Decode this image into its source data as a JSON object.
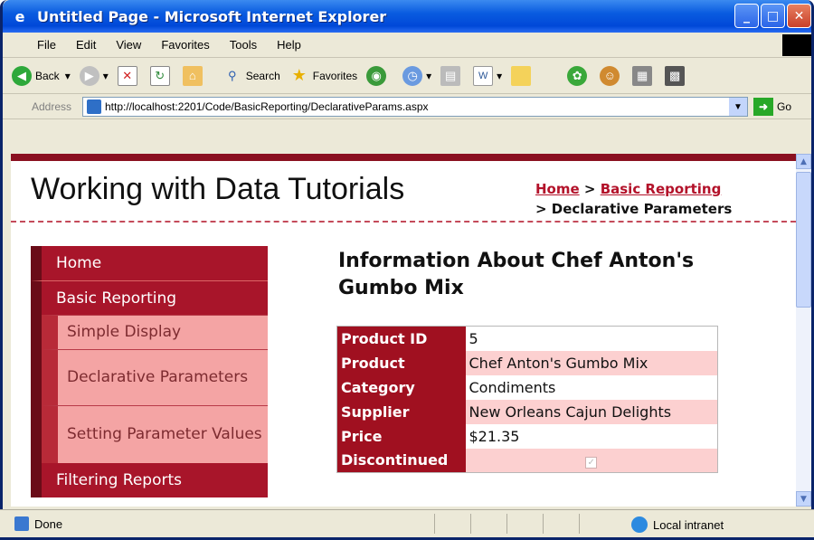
{
  "window": {
    "title": "Untitled Page - Microsoft Internet Explorer"
  },
  "menubar": {
    "items": [
      "File",
      "Edit",
      "View",
      "Favorites",
      "Tools",
      "Help"
    ]
  },
  "toolbar": {
    "back": "Back",
    "search": "Search",
    "favorites": "Favorites"
  },
  "address": {
    "label": "Address",
    "url": "http://localhost:2201/Code/BasicReporting/DeclarativeParams.aspx",
    "go": "Go"
  },
  "page": {
    "title": "Working with Data Tutorials",
    "breadcrumb": {
      "home": "Home",
      "sep1": " > ",
      "section": "Basic Reporting",
      "current": "> Declarative Parameters"
    },
    "heading": "Information About Chef Anton's Gumbo Mix",
    "menu": {
      "home": "Home",
      "basic_reporting": "Basic Reporting",
      "sub": [
        "Simple Display",
        "Declarative Parameters",
        "Setting Parameter Values"
      ],
      "filtering": "Filtering Reports"
    },
    "details": [
      {
        "label": "Product ID",
        "value": "5"
      },
      {
        "label": "Product",
        "value": "Chef Anton's Gumbo Mix"
      },
      {
        "label": "Category",
        "value": "Condiments"
      },
      {
        "label": "Supplier",
        "value": "New Orleans Cajun Delights"
      },
      {
        "label": "Price",
        "value": "$21.35"
      },
      {
        "label": "Discontinued",
        "value": ""
      }
    ],
    "discontinued_checked": true
  },
  "status": {
    "text": "Done",
    "zone": "Local intranet"
  },
  "colors": {
    "accent": "#a8152a",
    "submenu": "#f4a4a4",
    "title_bar": "#0048d8"
  }
}
